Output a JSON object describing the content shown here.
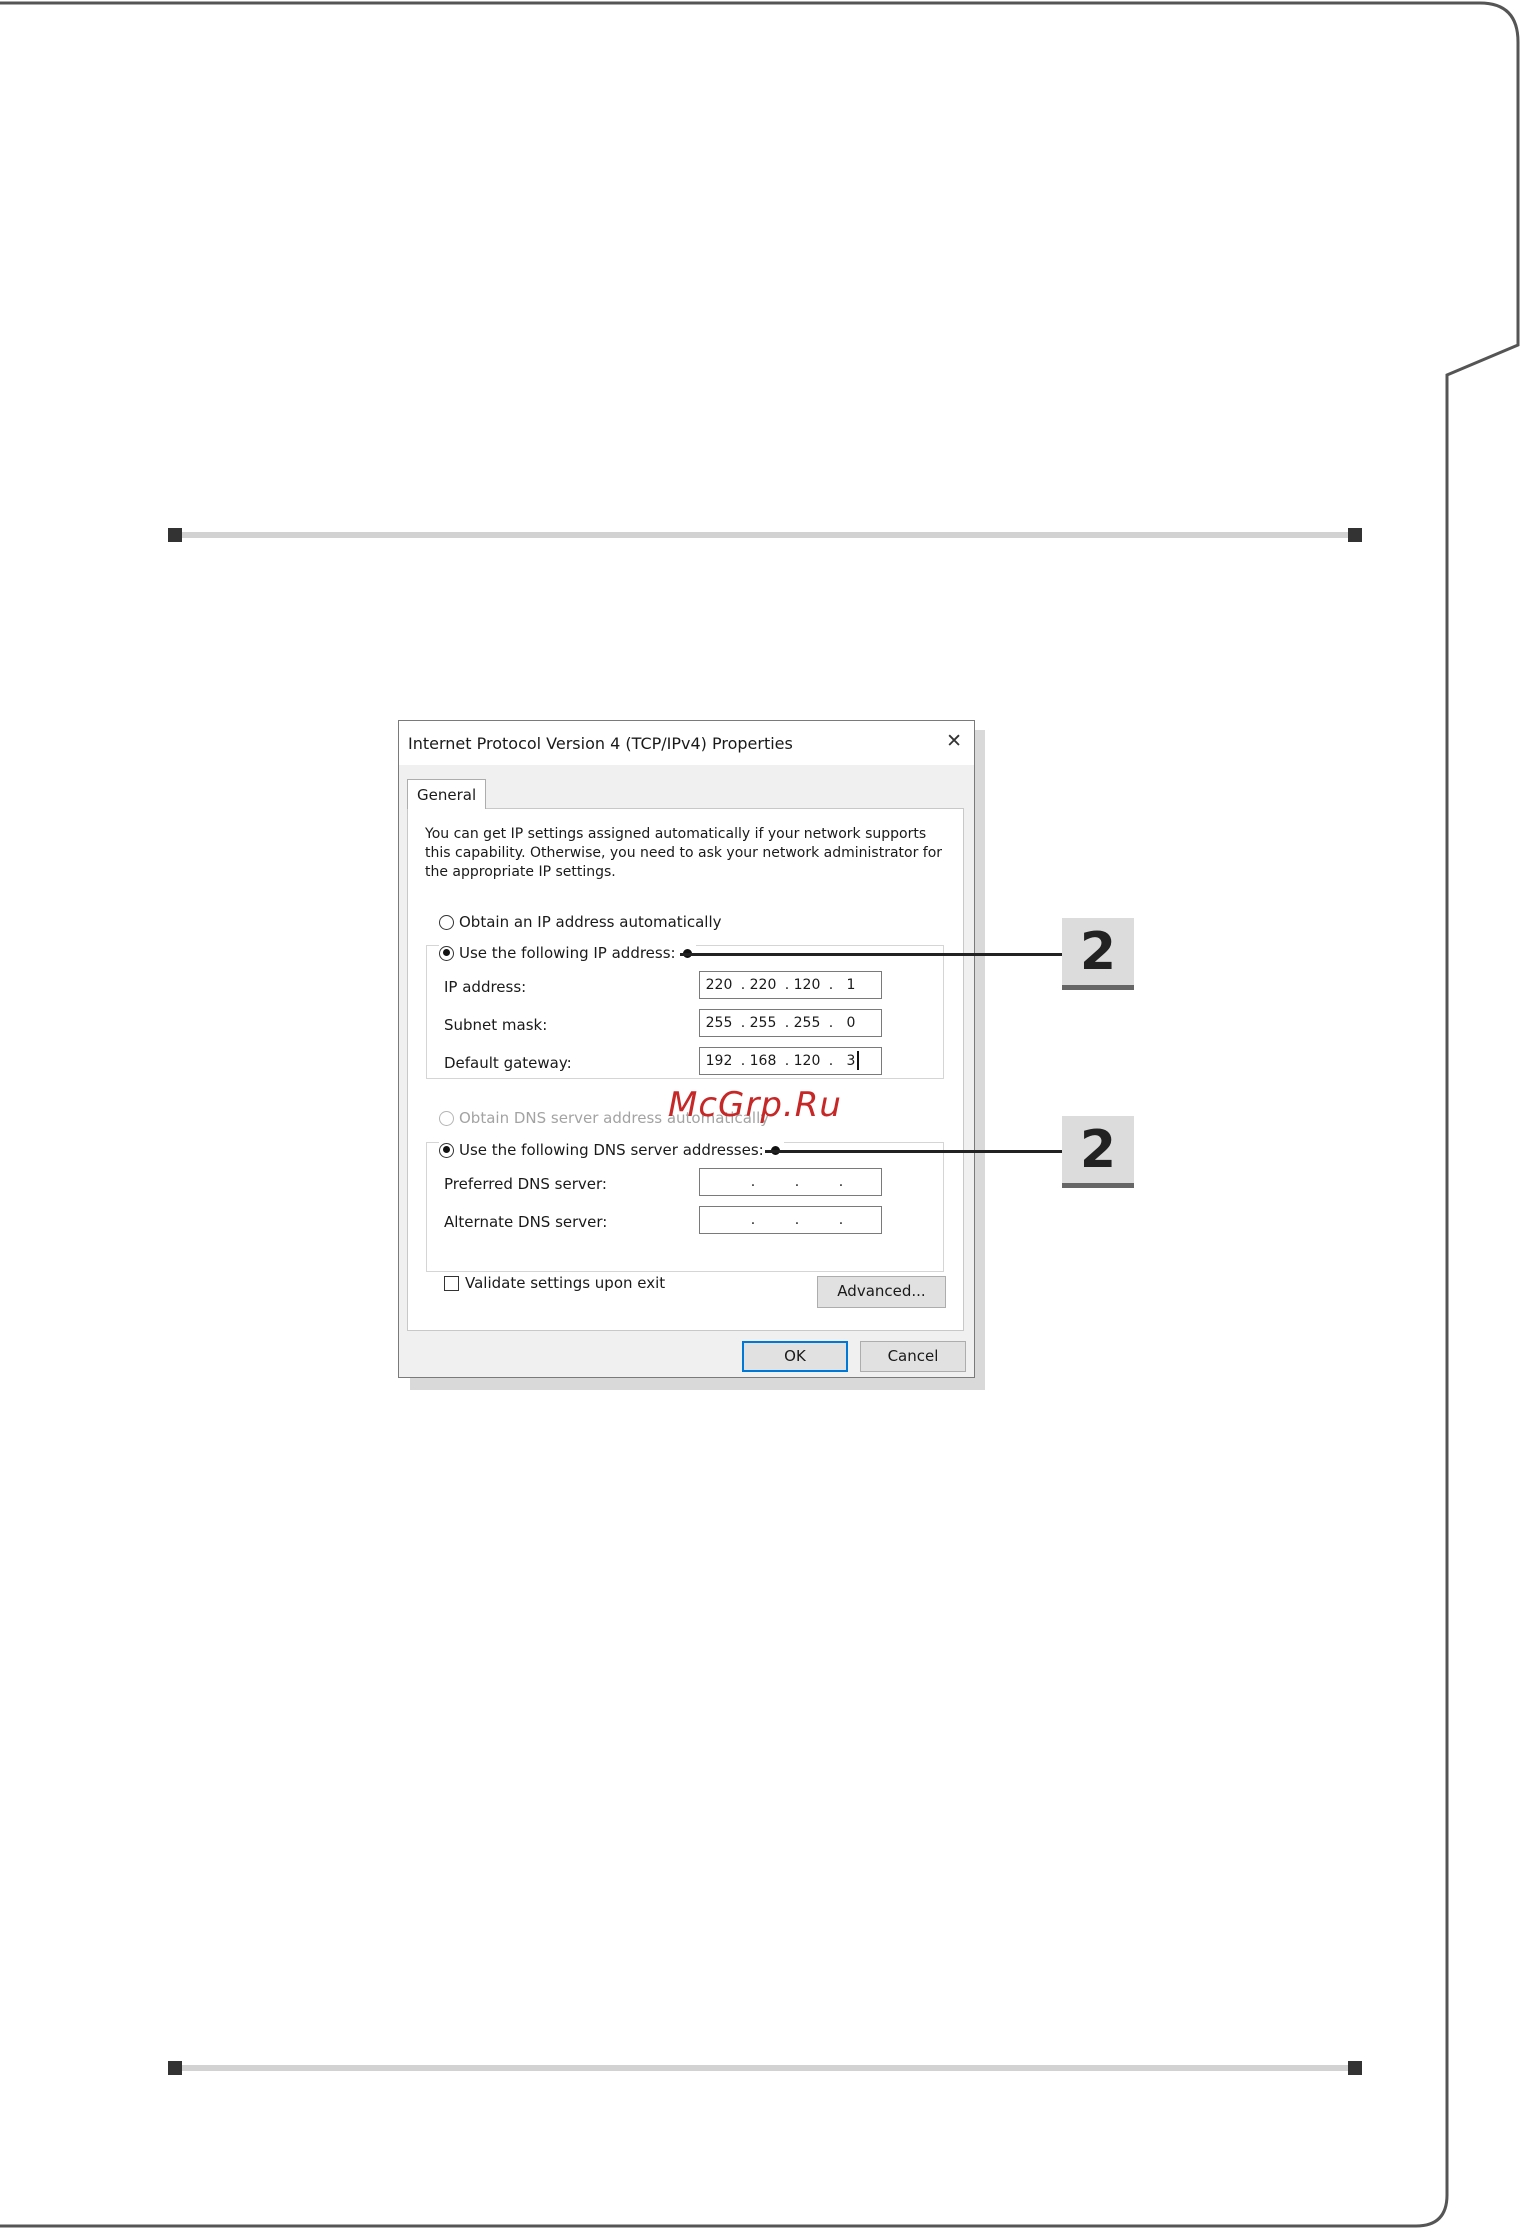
{
  "dialog": {
    "title": "Internet Protocol Version 4 (TCP/IPv4) Properties",
    "close_glyph": "✕",
    "tab_general": "General",
    "description": "You can get IP settings assigned automatically if your network supports this capability. Otherwise, you need to ask your network administrator for the appropriate IP settings.",
    "ip_section": {
      "obtain_auto_label": "Obtain an IP address automatically",
      "use_following_label": "Use the following IP address:",
      "selected": "use_following",
      "fields": [
        {
          "label": "IP address:",
          "octets": [
            "220",
            "220",
            "120",
            "1"
          ]
        },
        {
          "label": "Subnet mask:",
          "octets": [
            "255",
            "255",
            "255",
            "0"
          ]
        },
        {
          "label": "Default gateway:",
          "octets": [
            "192",
            "168",
            "120",
            "3"
          ]
        }
      ]
    },
    "dns_section": {
      "obtain_auto_label": "Obtain DNS server address automatically",
      "use_following_label": "Use the following DNS server addresses:",
      "selected": "use_following",
      "fields": [
        {
          "label": "Preferred DNS server:",
          "octets": [
            "",
            "",
            "",
            ""
          ]
        },
        {
          "label": "Alternate DNS server:",
          "octets": [
            "",
            "",
            "",
            ""
          ]
        }
      ]
    },
    "validate_label": "Validate settings upon exit",
    "validate_checked": false,
    "advanced_button": "Advanced...",
    "ok_button": "OK",
    "cancel_button": "Cancel"
  },
  "callouts": [
    {
      "number": "2",
      "target": "Use the following IP address"
    },
    {
      "number": "2",
      "target": "Use the following DNS server addresses"
    }
  ],
  "watermark": "McGrp.Ru",
  "colors": {
    "accent_blue": "#0078d7",
    "watermark_red": "#c62828",
    "badge_gray": "#dcdcdc",
    "rule_gray": "#d2d2d2"
  }
}
